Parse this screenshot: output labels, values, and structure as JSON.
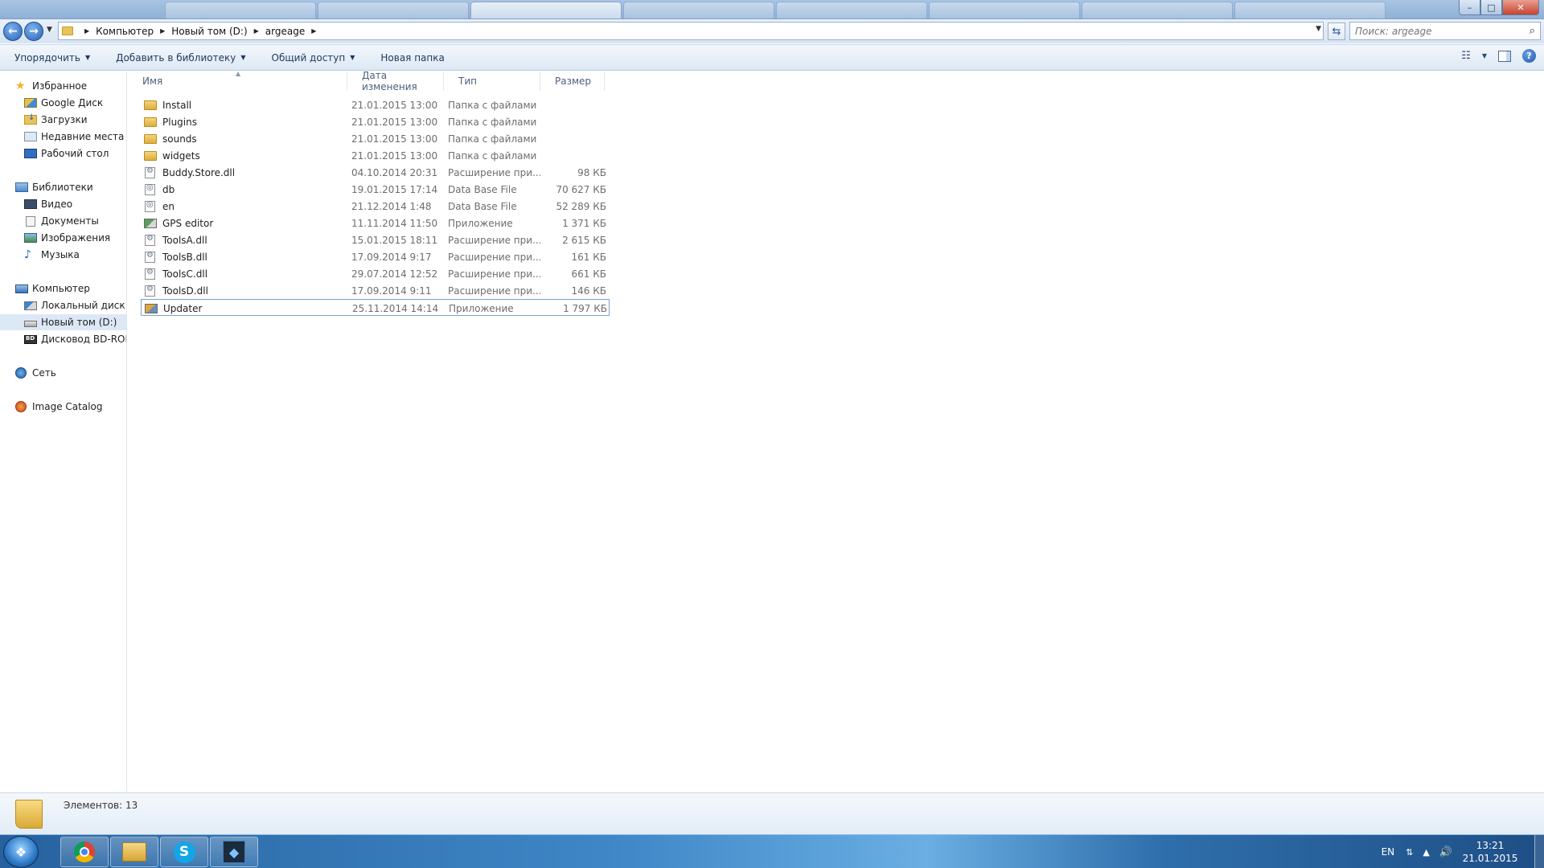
{
  "window": {
    "background_tabs_count": 8,
    "controls": {
      "minimize": "–",
      "maximize": "□",
      "close": "✕"
    }
  },
  "navbar": {
    "breadcrumbs": [
      "Компьютер",
      "Новый том (D:)",
      "argeage"
    ],
    "search_placeholder": "Поиск: argeage"
  },
  "commandbar": {
    "organize": "Упорядочить",
    "add_to_library": "Добавить в библиотеку",
    "share": "Общий доступ",
    "new_folder": "Новая папка"
  },
  "navpane": {
    "favorites": {
      "label": "Избранное",
      "items": [
        "Google Диск",
        "Загрузки",
        "Недавние места",
        "Рабочий стол"
      ]
    },
    "libraries": {
      "label": "Библиотеки",
      "items": [
        "Видео",
        "Документы",
        "Изображения",
        "Музыка"
      ]
    },
    "computer": {
      "label": "Компьютер",
      "items": [
        "Локальный диск (C",
        "Новый том (D:)",
        "Дисковод BD-ROM"
      ]
    },
    "network": {
      "label": "Сеть"
    },
    "image_catalog": {
      "label": "Image Catalog"
    }
  },
  "filelist": {
    "columns": {
      "name": "Имя",
      "date": "Дата изменения",
      "type": "Тип",
      "size": "Размер"
    },
    "rows": [
      {
        "name": "Install",
        "date": "21.01.2015 13:00",
        "type": "Папка с файлами",
        "size": "",
        "icon": "folder-icon"
      },
      {
        "name": "Plugins",
        "date": "21.01.2015 13:00",
        "type": "Папка с файлами",
        "size": "",
        "icon": "folder-icon"
      },
      {
        "name": "sounds",
        "date": "21.01.2015 13:00",
        "type": "Папка с файлами",
        "size": "",
        "icon": "folder-icon"
      },
      {
        "name": "widgets",
        "date": "21.01.2015 13:00",
        "type": "Папка с файлами",
        "size": "",
        "icon": "folder-icon"
      },
      {
        "name": "Buddy.Store.dll",
        "date": "04.10.2014 20:31",
        "type": "Расширение при...",
        "size": "98 КБ",
        "icon": "dll-file-icon"
      },
      {
        "name": "db",
        "date": "19.01.2015 17:14",
        "type": "Data Base File",
        "size": "70 627 КБ",
        "icon": "database-file-icon"
      },
      {
        "name": "en",
        "date": "21.12.2014 1:48",
        "type": "Data Base File",
        "size": "52 289 КБ",
        "icon": "database-file-icon"
      },
      {
        "name": "GPS editor",
        "date": "11.11.2014 11:50",
        "type": "Приложение",
        "size": "1 371 КБ",
        "icon": "application-icon"
      },
      {
        "name": "ToolsA.dll",
        "date": "15.01.2015 18:11",
        "type": "Расширение при...",
        "size": "2 615 КБ",
        "icon": "dll-file-icon"
      },
      {
        "name": "ToolsB.dll",
        "date": "17.09.2014 9:17",
        "type": "Расширение при...",
        "size": "161 КБ",
        "icon": "dll-file-icon"
      },
      {
        "name": "ToolsC.dll",
        "date": "29.07.2014 12:52",
        "type": "Расширение при...",
        "size": "661 КБ",
        "icon": "dll-file-icon"
      },
      {
        "name": "ToolsD.dll",
        "date": "17.09.2014 9:11",
        "type": "Расширение при...",
        "size": "146 КБ",
        "icon": "dll-file-icon"
      },
      {
        "name": "Updater",
        "date": "25.11.2014 14:14",
        "type": "Приложение",
        "size": "1 797 КБ",
        "icon": "updater-app-icon"
      }
    ]
  },
  "details": {
    "items_count": "Элементов: 13"
  },
  "taskbar": {
    "apps": [
      "chrome-icon",
      "explorer-icon",
      "skype-icon",
      "ide-icon"
    ],
    "skype_letter": "S",
    "lang": "EN",
    "time": "13:21",
    "date": "21.01.2015"
  }
}
